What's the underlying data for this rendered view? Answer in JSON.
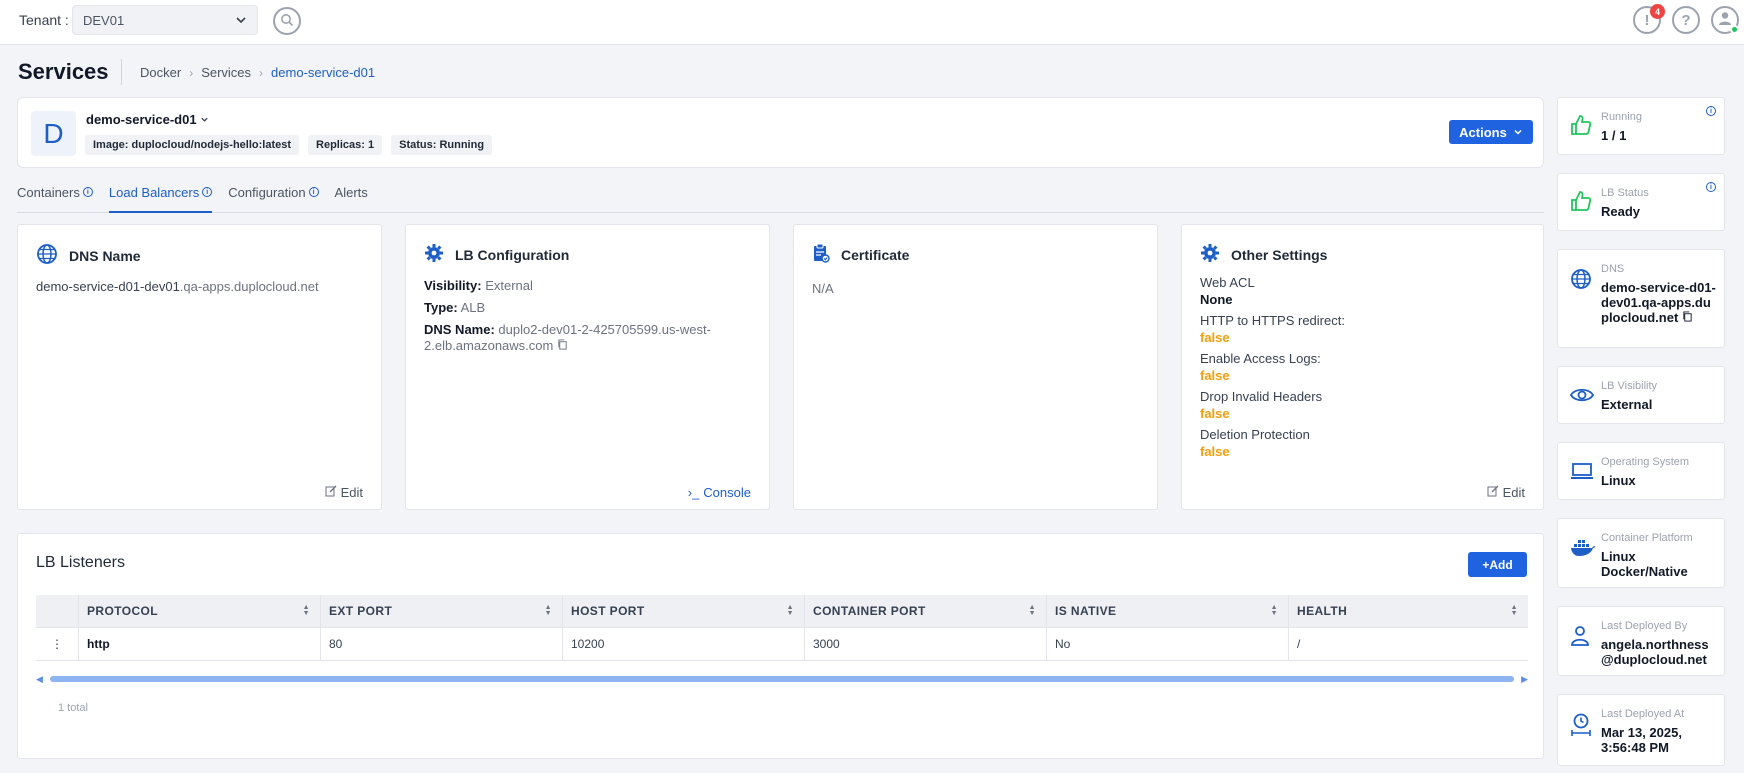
{
  "topbar": {
    "tenant_label": "Tenant :",
    "tenant_value": "DEV01",
    "notifications_count": "4"
  },
  "page": {
    "title": "Services",
    "breadcrumb": [
      "Docker",
      "Services",
      "demo-service-d01"
    ]
  },
  "service": {
    "avatar_letter": "D",
    "name": "demo-service-d01",
    "chips": [
      "Image: duplocloud/nodejs-hello:latest",
      "Replicas: 1",
      "Status: Running"
    ],
    "actions_label": "Actions"
  },
  "tabs": [
    {
      "label": "Containers",
      "info": true
    },
    {
      "label": "Load Balancers",
      "info": true,
      "active": true
    },
    {
      "label": "Configuration",
      "info": true
    },
    {
      "label": "Alerts",
      "info": false
    }
  ],
  "cards": {
    "dns": {
      "title": "DNS Name",
      "host": "demo-service-d01-dev01",
      "domain": ".qa-apps.duplocloud.net",
      "edit_label": "Edit"
    },
    "lb_config": {
      "title": "LB Configuration",
      "visibility_label": "Visibility:",
      "visibility_value": "External",
      "type_label": "Type:",
      "type_value": "ALB",
      "dns_label": "DNS Name:",
      "dns_value": "duplo2-dev01-2-425705599.us-west-2.elb.amazonaws.com",
      "console_label": "Console"
    },
    "certificate": {
      "title": "Certificate",
      "value": "N/A"
    },
    "other": {
      "title": "Other Settings",
      "web_acl_label": "Web ACL",
      "web_acl_value": "None",
      "settings": [
        {
          "label": "HTTP to HTTPS redirect:",
          "value": "false"
        },
        {
          "label": "Enable Access Logs:",
          "value": "false"
        },
        {
          "label": "Drop Invalid Headers",
          "value": "false"
        },
        {
          "label": "Deletion Protection",
          "value": "false"
        }
      ],
      "edit_label": "Edit"
    }
  },
  "listeners": {
    "title": "LB Listeners",
    "add_label": "+Add",
    "columns": [
      "PROTOCOL",
      "EXT PORT",
      "HOST PORT",
      "CONTAINER PORT",
      "IS NATIVE",
      "HEALTH"
    ],
    "rows": [
      [
        "http",
        "80",
        "10200",
        "3000",
        "No",
        "/"
      ]
    ],
    "total": "1 total"
  },
  "stats": [
    {
      "label": "Running",
      "value": "1 / 1",
      "icon": "thumbs-up-icon",
      "info": true
    },
    {
      "label": "LB Status",
      "value": "Ready",
      "icon": "thumbs-up-icon",
      "info": true
    },
    {
      "label": "DNS",
      "value": "demo-service-d01-dev01.qa-apps.duplocloud.net",
      "icon": "globe-icon",
      "info": false
    },
    {
      "label": "LB Visibility",
      "value": "External",
      "icon": "eye-icon",
      "info": false
    },
    {
      "label": "Operating System",
      "value": "Linux",
      "icon": "laptop-icon",
      "info": false
    },
    {
      "label": "Container Platform",
      "value": "Linux Docker/Native",
      "icon": "docker-icon",
      "info": false
    },
    {
      "label": "Last Deployed By",
      "value": "angela.northness@duplocloud.net",
      "icon": "user-icon",
      "info": false
    },
    {
      "label": "Last Deployed At",
      "value": "Mar 13, 2025, 3:56:48 PM",
      "icon": "clock-icon",
      "info": false
    }
  ],
  "colors": {
    "primary": "#1f63e0",
    "link": "#1d5ec7",
    "false_value": "#f59e0b",
    "running": "#22c55e"
  }
}
